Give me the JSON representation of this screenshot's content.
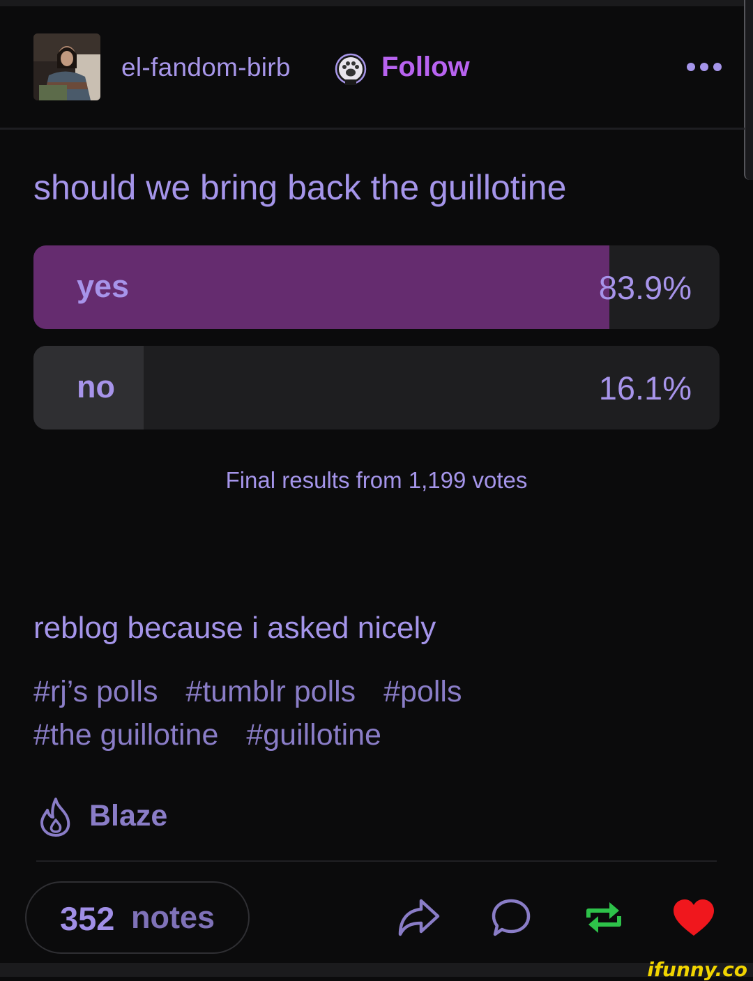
{
  "post": {
    "username": "el-fandom-birb",
    "follow_label": "Follow"
  },
  "poll": {
    "question": "should we bring back the guillotine",
    "options": [
      {
        "label": "yes",
        "percent_text": "83.9%",
        "percent": 83.9
      },
      {
        "label": "no",
        "percent_text": "16.1%",
        "percent": 16.1
      }
    ],
    "results_text": "Final results from 1,199 votes"
  },
  "caption": "reblog because i asked nicely",
  "tags": [
    "#rj’s polls",
    "#tumblr polls",
    "#polls",
    "#the guillotine",
    "#guillotine"
  ],
  "blaze_label": "Blaze",
  "notes": {
    "count": "352",
    "label": "notes"
  },
  "watermark": "ifunny.co",
  "icons": {
    "badge": "paw-icon",
    "more": "ellipsis-icon",
    "blaze": "flame-icon",
    "share": "share-icon",
    "reply": "comment-icon",
    "reblog": "reblog-icon",
    "like": "heart-icon"
  },
  "colors": {
    "background": "#0b0b0c",
    "accent_text": "#a595ea",
    "follow": "#b863f0",
    "poll_fill_yes": "#652c6f",
    "reblog": "#2ec24a",
    "like": "#f0171d"
  }
}
